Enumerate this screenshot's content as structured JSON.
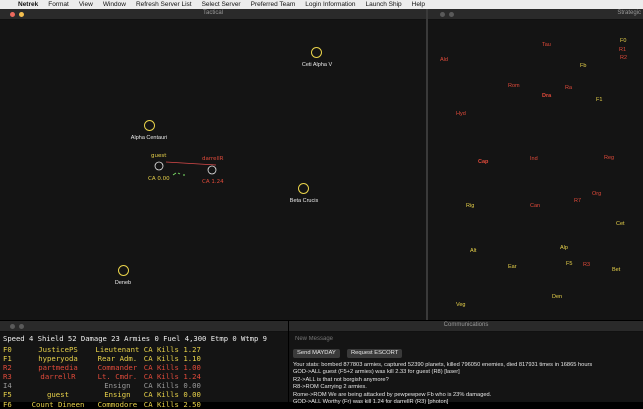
{
  "menubar": {
    "apple": "",
    "app": "Netrek",
    "items": [
      "Format",
      "View",
      "Window",
      "Refresh Server List",
      "Select Server",
      "Preferred Team",
      "Login Information",
      "Launch Ship",
      "Help"
    ]
  },
  "tactical": {
    "title": "Tactical",
    "planets": [
      {
        "name": "Ceti Alpha V"
      },
      {
        "name": "Alpha Centauri"
      },
      {
        "name": "Beta Crucis"
      },
      {
        "name": "Deneb"
      }
    ],
    "ships": {
      "guest": {
        "name": "guest",
        "ca": "CA 0.00"
      },
      "darrell": {
        "name": "darrellR",
        "ca": "CA 1.24"
      }
    }
  },
  "galactic": {
    "title": "Strategic",
    "labels": [
      {
        "text": "Tau",
        "color": "#e04a3a"
      },
      {
        "text": "F0",
        "color": "#e8d24a"
      },
      {
        "text": "R1",
        "color": "#e04a3a"
      },
      {
        "text": "R2",
        "color": "#e04a3a"
      },
      {
        "text": "Ald",
        "color": "#e04a3a"
      },
      {
        "text": "Fb",
        "color": "#e8d24a"
      },
      {
        "text": "Rom",
        "color": "#e04a3a"
      },
      {
        "text": "Ra",
        "color": "#e04a3a"
      },
      {
        "text": "Dra",
        "color": "#e04a3a"
      },
      {
        "text": "F1",
        "color": "#e8d24a"
      },
      {
        "text": "Hyd",
        "color": "#e04a3a"
      },
      {
        "text": "Cap",
        "color": "#e04a3a"
      },
      {
        "text": "Ind",
        "color": "#e04a3a"
      },
      {
        "text": "Reg",
        "color": "#e04a3a"
      },
      {
        "text": "Rig",
        "color": "#e8d24a"
      },
      {
        "text": "Can",
        "color": "#e04a3a"
      },
      {
        "text": "R7",
        "color": "#e04a3a"
      },
      {
        "text": "Org",
        "color": "#e04a3a"
      },
      {
        "text": "Cet",
        "color": "#e8d24a"
      },
      {
        "text": "Alt",
        "color": "#e8d24a"
      },
      {
        "text": "Alp",
        "color": "#e8d24a"
      },
      {
        "text": "Ear",
        "color": "#e8d24a"
      },
      {
        "text": "F5",
        "color": "#e8d24a"
      },
      {
        "text": "R3",
        "color": "#e04a3a"
      },
      {
        "text": "Bet",
        "color": "#e8d24a"
      },
      {
        "text": "Den",
        "color": "#e8d24a"
      },
      {
        "text": "Veg",
        "color": "#e8d24a"
      }
    ]
  },
  "status": {
    "line": "Speed 4 Shield 52 Damage 23 Armies 0 Fuel 4,300 Etmp 0 Wtmp 9"
  },
  "players": [
    {
      "id": "F0",
      "name": "JusticePS",
      "rank": "Lieutenant",
      "kills": "CA Kills 1.27",
      "color": "#e8d24a"
    },
    {
      "id": "F1",
      "name": "hyperyoda",
      "rank": "Rear Adm.",
      "kills": "CA Kills 1.10",
      "color": "#e8d24a"
    },
    {
      "id": "R2",
      "name": "partmedia",
      "rank": "Commander",
      "kills": "CA Kills 1.00",
      "color": "#e04a3a"
    },
    {
      "id": "R3",
      "name": "darrellR",
      "rank": "Lt. Cmdr.",
      "kills": "CA Kills 1.24",
      "color": "#e04a3a"
    },
    {
      "id": "I4",
      "name": "",
      "rank": "Ensign",
      "kills": "CA Kills 0.00",
      "color": "#9a9a9a"
    },
    {
      "id": "F5",
      "name": "guest",
      "rank": "Ensign",
      "kills": "CA Kills 0.00",
      "color": "#e8d24a"
    },
    {
      "id": "F6",
      "name": "Count Dineen",
      "rank": "Commodore",
      "kills": "CA Kills 2.50",
      "color": "#e8d24a"
    }
  ],
  "comms": {
    "title": "Communications",
    "placeholder": "New Message",
    "mayday": "Send MAYDAY",
    "escort": "Request ESCORT",
    "log": [
      "Your stats: bombed 877803 armies, captured 52390 planets, killed 796050 enemies, died 817931 times in 16865 hours",
      "GOD->ALL  guest (F5+2 armies) was kill 2.33 for guest (R8) [laser]",
      " R2->ALL  is that not borgish anymore?",
      " R8->ROM  Carrying 2 armies.",
      "Rome->ROM We are being attacked by pewpewpew Fb who is 23% damaged.",
      "GOD->ALL  Worthy (Fr) was kill 1.24 for darrellR (R3) [photon]"
    ]
  }
}
